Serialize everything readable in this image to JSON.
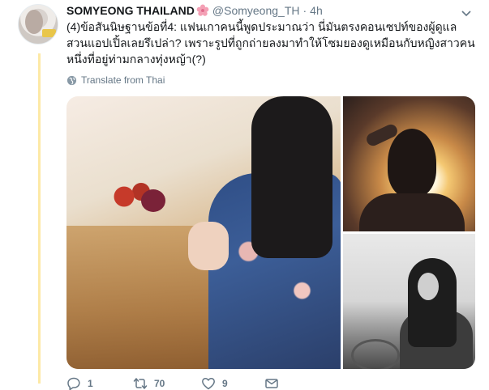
{
  "tweet": {
    "author_name": "SOMYEONG THAILAND",
    "handle": "@Somyeong_TH",
    "separator": "·",
    "time": "4h",
    "text": "(4)ข้อสันนิษฐานข้อที่4: แฟนเกาคนนี้พูดประมาณว่า นี่มันตรงคอนเซปท์ของผู้ดูแลสวนแอปเปิ้ลเลยรึเปล่า? เพราะรูปที่ถูกถ่ายลงมาทำให้โซมยองดูเหมือนกับหญิงสาวคนหนึ่งที่อยู่ท่ามกลางทุ่งหญ้า(?)",
    "translate_label": "Translate from Thai",
    "actions": {
      "reply_count": "1",
      "retweet_count": "70",
      "like_count": "9"
    }
  },
  "colors": {
    "text_primary": "#14171a",
    "text_secondary": "#657786",
    "thread_line": "#fde9a6",
    "flower_emoji": "#f4a0b5"
  },
  "icons": [
    "cherry-blossom-icon",
    "chevron-down-icon",
    "globe-icon",
    "reply-icon",
    "retweet-icon",
    "like-icon",
    "direct-message-icon"
  ]
}
